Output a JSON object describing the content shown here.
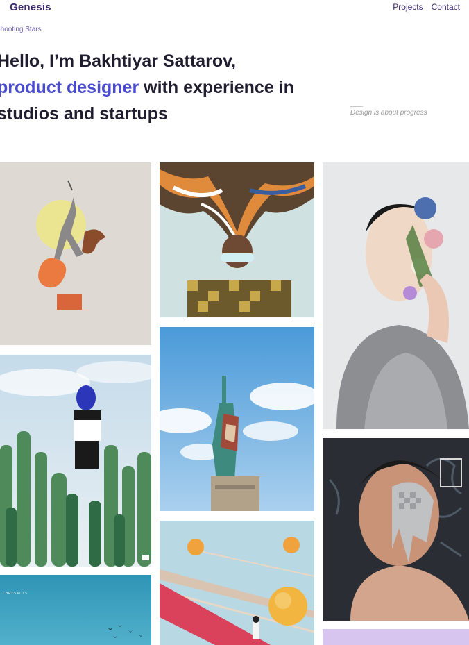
{
  "header": {
    "brand": "Genesis",
    "nav": [
      "Projects",
      "Contact"
    ]
  },
  "breadcrumb": "Shooting Stars",
  "hero": {
    "line1": "Hello, I’m Bakhtiyar Sattarov,",
    "accent": "product designer",
    "line2_rest": " with experience in",
    "line3": "studios and startups"
  },
  "tagline": "Design is about progress",
  "colors": {
    "brand": "#3c2a6e",
    "accent": "#4a4bd1",
    "text": "#1f1d2e",
    "muted": "#9a9a9a"
  },
  "gallery": {
    "tiles": [
      {
        "subject": "dancer-collage-artwork"
      },
      {
        "subject": "cactus-balloon-photo"
      },
      {
        "subject": "teal-sky-birds-photo",
        "caption": "CHRYSALIS"
      },
      {
        "subject": "exploding-head-illustration"
      },
      {
        "subject": "statue-of-liberty-photo"
      },
      {
        "subject": "red-carpet-orange-spheres-artwork"
      },
      {
        "subject": "flower-face-portrait"
      },
      {
        "subject": "graffiti-mask-portrait"
      },
      {
        "subject": "lavender-placeholder"
      }
    ]
  }
}
